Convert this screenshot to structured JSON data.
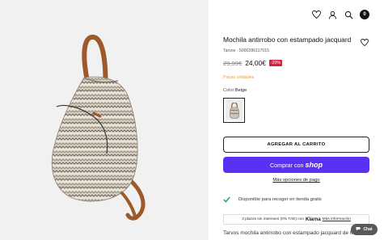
{
  "header": {
    "cart_count": "0",
    "icons": [
      "heart-icon",
      "user-icon",
      "search-icon",
      "cart-icon"
    ]
  },
  "product": {
    "title": "Mochila antirrobo con estampado jacquard",
    "sku": "Tarvos - 5000286117015",
    "old_price": "29,99€",
    "new_price": "24,00€",
    "discount": "-20%",
    "stock_status": "Pocas unidades",
    "color_label": "Color:",
    "color_value": "Beige",
    "description": "Tarvos mochila antirrobo con estampado jacquard de Misako"
  },
  "actions": {
    "add_to_cart": "AGREGAR AL CARRITO",
    "buy_with": "Comprar con",
    "shop_brand": "shop",
    "more_options": "Más opciones de pago"
  },
  "availability": {
    "text": "Disponible para recoger en tienda gratis"
  },
  "klarna": {
    "prefix": "3 plazos sin intereses (0% TAE) con",
    "brand": "Klarna",
    "link": "Más información"
  },
  "chat": {
    "label": "Chat"
  },
  "colors": {
    "accent": "#5a31f4",
    "discount": "#d1243a",
    "stock": "#e59a3b",
    "check": "#27a559"
  }
}
